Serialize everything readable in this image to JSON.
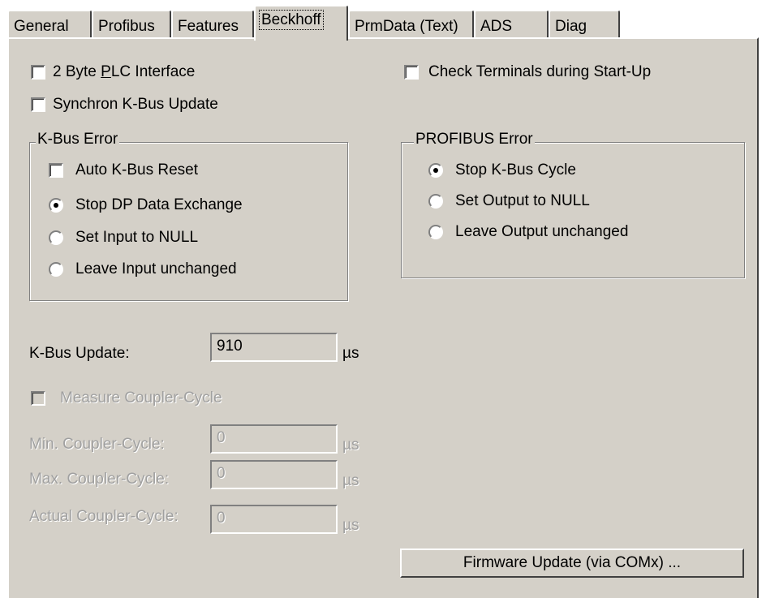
{
  "tabs": [
    "General",
    "Profibus",
    "Features",
    "Beckhoff",
    "PrmData (Text)",
    "ADS",
    "Diag"
  ],
  "active_tab": "Beckhoff",
  "options": {
    "two_byte_plc": {
      "pre": "2 Byte ",
      "mnemonic": "P",
      "post": "LC Interface",
      "checked": false
    },
    "synchron_kbus": {
      "label": "Synchron K-Bus Update",
      "checked": false
    },
    "check_terminals": {
      "label": "Check Terminals during Start-Up",
      "checked": false
    }
  },
  "kbus_error": {
    "legend": "K-Bus Error",
    "auto_reset_label": "Auto K-Bus Reset",
    "radios": [
      "Stop DP Data Exchange",
      "Set Input to NULL",
      "Leave Input unchanged"
    ],
    "selected": "Stop DP Data Exchange"
  },
  "profibus_error": {
    "legend": "PROFIBUS Error",
    "radios": [
      "Stop K-Bus Cycle",
      "Set Output to NULL",
      "Leave Output unchanged"
    ],
    "selected": "Stop K-Bus Cycle"
  },
  "kbus_update": {
    "label": "K-Bus Update:",
    "value": "910",
    "unit": "µs"
  },
  "measure": {
    "label": "Measure Coupler-Cycle",
    "fields": [
      {
        "label": "Min. Coupler-Cycle:",
        "value": "0",
        "unit": "µs"
      },
      {
        "label": "Max. Coupler-Cycle:",
        "value": "0",
        "unit": "µs"
      },
      {
        "label": "Actual Coupler-Cycle:",
        "value": "0",
        "unit": "µs"
      }
    ]
  },
  "firmware_button": "Firmware Update (via COMx) ..."
}
